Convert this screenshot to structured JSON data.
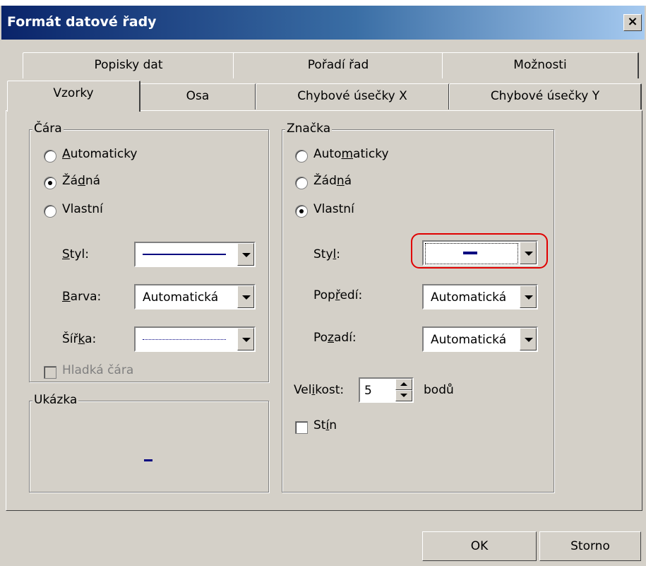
{
  "window": {
    "title": "Formát datové řady",
    "close_label": "×"
  },
  "tabs_back": [
    "Popisky dat",
    "Pořadí řad",
    "Možnosti"
  ],
  "tabs_front": [
    "Vzorky",
    "Osa",
    "Chybové úsečky X",
    "Chybové úsečky Y"
  ],
  "line_group": {
    "title": "Čára",
    "options": [
      {
        "label_pre": "",
        "label_u": "A",
        "label_post": "utomaticky",
        "selected": false
      },
      {
        "label_pre": "Žá",
        "label_u": "d",
        "label_post": "ná",
        "selected": true
      },
      {
        "label_pre": "Vlastní",
        "label_u": "",
        "label_post": "",
        "selected": false
      }
    ],
    "style_label_u": "S",
    "style_label_post": "tyl:",
    "color_label_u": "B",
    "color_label_post": "arva:",
    "color_value": "Automatická",
    "width_label_pre": "Šíř",
    "width_label_u": "k",
    "width_label_post": "a:",
    "smooth_label": "Hladká čára"
  },
  "preview_group": {
    "title": "Ukázka"
  },
  "marker_group": {
    "title": "Značka",
    "options": [
      {
        "label_pre": "Auto",
        "label_u": "m",
        "label_post": "aticky",
        "selected": false
      },
      {
        "label_pre": "Žád",
        "label_u": "n",
        "label_post": "á",
        "selected": false
      },
      {
        "label_pre": "Vlastní",
        "label_u": "",
        "label_post": "",
        "selected": true
      }
    ],
    "style_label_pre": "Sty",
    "style_label_u": "l",
    "style_label_post": ":",
    "fg_label_pre": "Pop",
    "fg_label_u": "ř",
    "fg_label_post": "edí:",
    "fg_value": "Automatická",
    "bg_label_pre": "Po",
    "bg_label_u": "z",
    "bg_label_post": "adí:",
    "bg_value": "Automatická",
    "size_label_pre": "Vel",
    "size_label_u": "i",
    "size_label_post": "kost:",
    "size_value": "5",
    "size_unit": "bodů",
    "shadow_label_pre": "St",
    "shadow_label_u": "í",
    "shadow_label_post": "n"
  },
  "buttons": {
    "ok": "OK",
    "cancel": "Storno"
  },
  "colors": {
    "title_start": "#0a246a",
    "title_end": "#a6caf0",
    "face": "#d4d0c8",
    "highlight_ring": "#e00000",
    "line_color": "#000080"
  }
}
